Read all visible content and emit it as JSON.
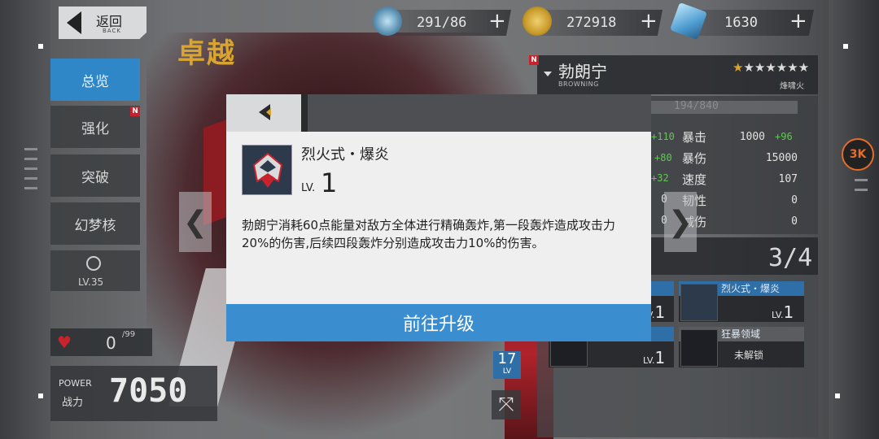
{
  "header": {
    "back_label": "返回",
    "back_sub": "BACK",
    "page_title_art": "卓越"
  },
  "currencies": [
    {
      "icon": "energy-crystal-icon",
      "value": "291/86"
    },
    {
      "icon": "gold-coin-icon",
      "value": "272918"
    },
    {
      "icon": "blue-gem-icon",
      "value": "1630"
    }
  ],
  "plus_symbol": "+",
  "menu": {
    "items": [
      {
        "label": "总览",
        "active": true
      },
      {
        "label": "强化",
        "badge": "N"
      },
      {
        "label": "突破"
      },
      {
        "label": "幻梦核"
      }
    ],
    "locked_label": "LV.35"
  },
  "hearts": {
    "current": "0",
    "max": "/99"
  },
  "power": {
    "label_en": "POWER",
    "label_cn": "战力",
    "value": "7050"
  },
  "character": {
    "badge": "N",
    "name": "勃朗宁",
    "name_en": "BROWNING",
    "stars_filled": 1,
    "stars_total": 7,
    "attribute": "烽啸火",
    "exp": "194/840",
    "stats_right": [
      {
        "name": "暴击",
        "value": "1000",
        "bonus": "+96"
      },
      {
        "name": "暴伤",
        "value": "15000"
      },
      {
        "name": "速度",
        "value": "107"
      },
      {
        "name": "韧性",
        "value": "0"
      },
      {
        "name": "减伤",
        "value": "0"
      }
    ],
    "stats_left_bonus": [
      "+110",
      "+80",
      "+32"
    ],
    "stats_left_zero": [
      "0",
      "0"
    ],
    "skill_count": "3/4",
    "level_num": "17",
    "level_lbl": "LV"
  },
  "skill_cards": [
    {
      "title": "",
      "lv_prefix": "LV.",
      "lv": "1",
      "locked": false
    },
    {
      "title": "烈火式・爆炎",
      "lv_prefix": "LV.",
      "lv": "1",
      "locked": false
    },
    {
      "title": "",
      "lv_prefix": "LV.",
      "lv": "1",
      "locked": false
    },
    {
      "title": "狂暴领域",
      "locked_label": "未解锁",
      "locked": true
    }
  ],
  "side_badge": "3K",
  "nav": {
    "prev": "❮",
    "next": "❯"
  },
  "expand_symbol": "⤧",
  "modal": {
    "skill_name": "烈火式・爆炎",
    "level_label": "LV.",
    "level_value": "1",
    "description": "勃朗宁消耗60点能量对敌方全体进行精确轰炸,第一段轰炸造成攻击力20%的伤害,后续四段轰炸分别造成攻击力10%的伤害。",
    "upgrade_button": "前往升级"
  },
  "colors": {
    "accent_blue": "#3a8ed0",
    "menu_active": "#2f87c8",
    "gold": "#d9a532",
    "badge_red": "#c8232c",
    "bonus_green": "#62c655"
  }
}
